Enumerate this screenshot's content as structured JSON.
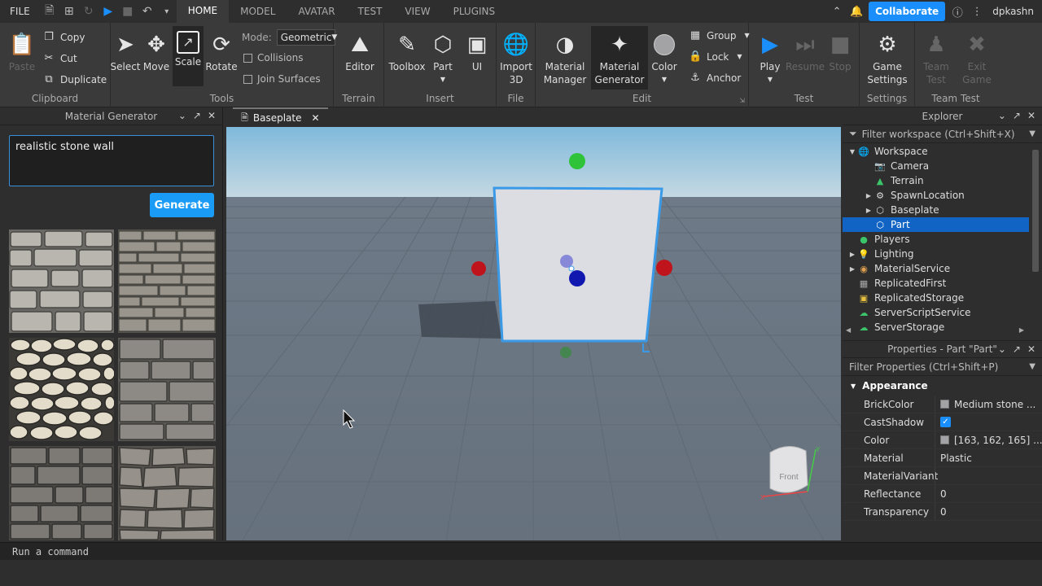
{
  "menu": {
    "file": "FILE",
    "tabs": [
      "HOME",
      "MODEL",
      "AVATAR",
      "TEST",
      "VIEW",
      "PLUGINS"
    ],
    "active_tab": "HOME",
    "collaborate": "Collaborate",
    "username": "dpkashn"
  },
  "ribbon": {
    "clipboard": {
      "label": "Clipboard",
      "paste": "Paste",
      "copy": "Copy",
      "cut": "Cut",
      "duplicate": "Duplicate"
    },
    "tools": {
      "label": "Tools",
      "select": "Select",
      "move": "Move",
      "scale": "Scale",
      "rotate": "Rotate",
      "mode_label": "Mode:",
      "mode_value": "Geometric",
      "collisions": "Collisions",
      "join_surfaces": "Join Surfaces"
    },
    "terrain": {
      "label": "Terrain",
      "editor": "Editor"
    },
    "insert": {
      "label": "Insert",
      "toolbox": "Toolbox",
      "part": "Part",
      "ui": "UI"
    },
    "file": {
      "label": "File",
      "import3d_line1": "Import",
      "import3d_line2": "3D"
    },
    "edit": {
      "label": "Edit",
      "material_manager_1": "Material",
      "material_manager_2": "Manager",
      "material_generator_1": "Material",
      "material_generator_2": "Generator",
      "color": "Color",
      "group": "Group",
      "lock": "Lock",
      "anchor": "Anchor"
    },
    "test": {
      "label": "Test",
      "play": "Play",
      "resume": "Resume",
      "stop": "Stop"
    },
    "settings": {
      "label": "Settings",
      "game_settings_1": "Game",
      "game_settings_2": "Settings"
    },
    "team_test": {
      "label": "Team Test",
      "team_test_1": "Team",
      "team_test_2": "Test",
      "exit_game_1": "Exit",
      "exit_game_2": "Game"
    }
  },
  "material_generator": {
    "title": "Material Generator",
    "prompt": "realistic stone wall",
    "generate": "Generate"
  },
  "viewport": {
    "tab": "Baseplate",
    "view_cube_label": "Front"
  },
  "explorer": {
    "title": "Explorer",
    "filter": "Filter workspace (Ctrl+Shift+X)",
    "items": [
      {
        "label": "Workspace"
      },
      {
        "label": "Camera"
      },
      {
        "label": "Terrain"
      },
      {
        "label": "SpawnLocation"
      },
      {
        "label": "Baseplate"
      },
      {
        "label": "Part"
      },
      {
        "label": "Players"
      },
      {
        "label": "Lighting"
      },
      {
        "label": "MaterialService"
      },
      {
        "label": "ReplicatedFirst"
      },
      {
        "label": "ReplicatedStorage"
      },
      {
        "label": "ServerScriptService"
      },
      {
        "label": "ServerStorage"
      }
    ]
  },
  "properties": {
    "title": "Properties - Part \"Part\"",
    "filter": "Filter Properties (Ctrl+Shift+P)",
    "section": "Appearance",
    "rows": [
      {
        "name": "BrickColor",
        "value": "Medium stone ..."
      },
      {
        "name": "CastShadow",
        "value": ""
      },
      {
        "name": "Color",
        "value": "[163, 162, 165] ..."
      },
      {
        "name": "Material",
        "value": "Plastic"
      },
      {
        "name": "MaterialVariant",
        "value": ""
      },
      {
        "name": "Reflectance",
        "value": "0"
      },
      {
        "name": "Transparency",
        "value": "0"
      }
    ]
  },
  "command_bar": {
    "placeholder": "Run a command"
  },
  "colors": {
    "accent": "#1a8ffb",
    "selection": "#1264c4",
    "panel": "#2e2e2e",
    "ribbon": "#3a3a3a"
  }
}
